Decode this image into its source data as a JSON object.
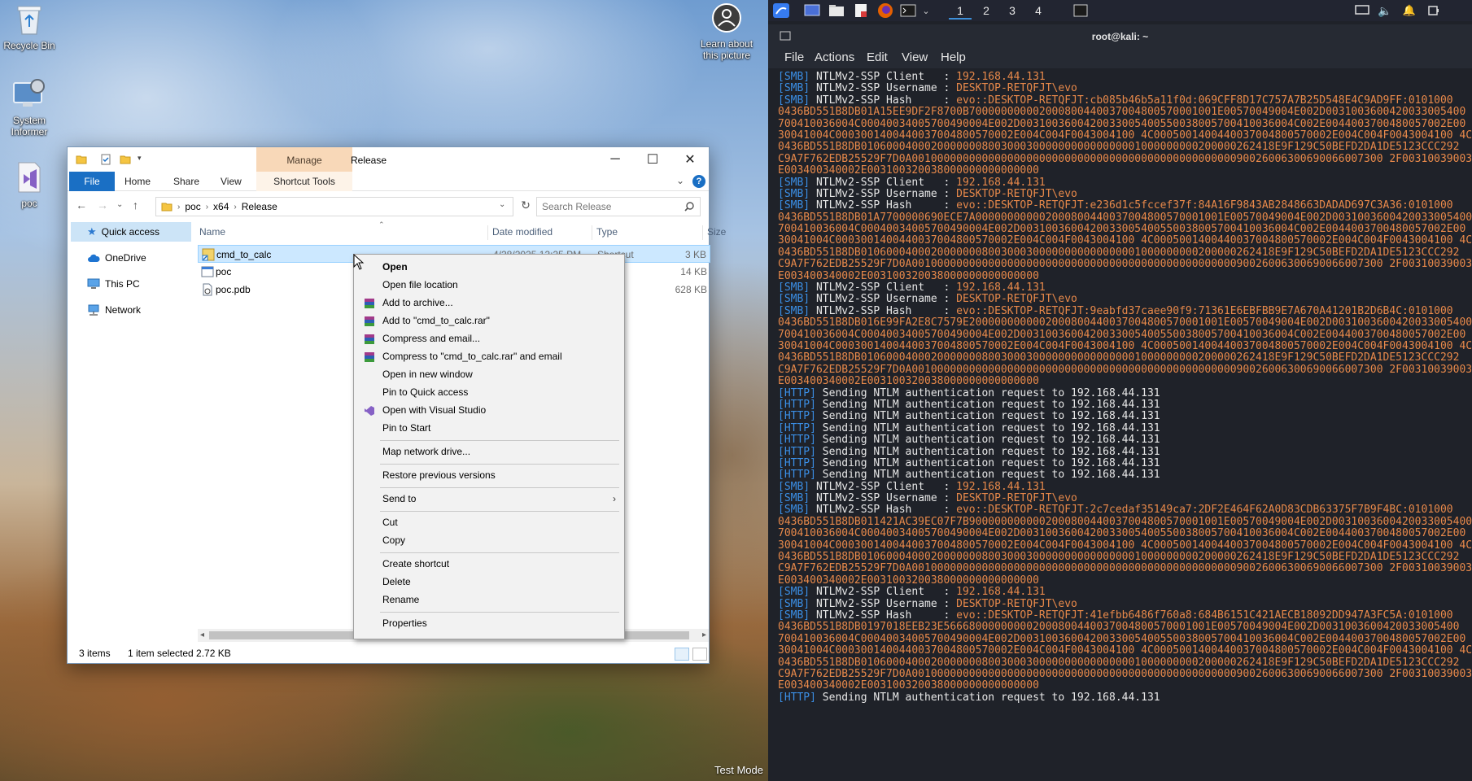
{
  "desktop": {
    "icons": [
      {
        "label": "Recycle Bin",
        "icon": "recycle-bin-icon"
      },
      {
        "label": "System\nInformer",
        "icon": "system-informer-icon"
      },
      {
        "label": "poc",
        "icon": "visual-studio-solution-icon"
      }
    ],
    "learn_label": "Learn about\nthis picture",
    "test_mode": "Test Mode"
  },
  "explorer": {
    "manage_tab": "Manage",
    "title": "Release",
    "ribbon_tabs": {
      "file": "File",
      "home": "Home",
      "share": "Share",
      "view": "View",
      "shortcut_tools": "Shortcut Tools"
    },
    "breadcrumb": [
      "poc",
      "x64",
      "Release"
    ],
    "search_placeholder": "Search Release",
    "nav": {
      "quick_access": "Quick access",
      "onedrive": "OneDrive",
      "this_pc": "This PC",
      "network": "Network"
    },
    "columns": {
      "name": "Name",
      "date": "Date modified",
      "type": "Type",
      "size": "Size"
    },
    "files": [
      {
        "name": "cmd_to_calc",
        "date": "4/28/2025 12:25 PM",
        "type": "Shortcut",
        "size": "3 KB"
      },
      {
        "name": "poc",
        "date": "",
        "type": "",
        "size": "14 KB"
      },
      {
        "name": "poc.pdb",
        "date": "",
        "type": "",
        "size": "628 KB"
      }
    ],
    "status": {
      "items": "3 items",
      "selected": "1 item selected  2.72 KB"
    }
  },
  "context_menu": {
    "open": "Open",
    "open_location": "Open file location",
    "add_archive": "Add to archive...",
    "add_rar": "Add to \"cmd_to_calc.rar\"",
    "compress_email": "Compress and email...",
    "compress_rar_email": "Compress to \"cmd_to_calc.rar\" and email",
    "open_new_window": "Open in new window",
    "pin_quick": "Pin to Quick access",
    "open_vs": "Open with Visual Studio",
    "pin_start": "Pin to Start",
    "map_drive": "Map network drive...",
    "restore": "Restore previous versions",
    "send_to": "Send to",
    "cut": "Cut",
    "copy": "Copy",
    "create_shortcut": "Create shortcut",
    "delete": "Delete",
    "rename": "Rename",
    "properties": "Properties"
  },
  "kali": {
    "workspaces": [
      "1",
      "2",
      "3",
      "4"
    ],
    "window_title": "root@kali: ~",
    "menu": {
      "file": "File",
      "actions": "Actions",
      "edit": "Edit",
      "view": "View",
      "help": "Help"
    },
    "smb_tag": "[SMB]",
    "http_tag": "[HTTP]",
    "label_client": " NTLMv2-SSP Client   : ",
    "label_username": " NTLMv2-SSP Username : ",
    "label_hash": " NTLMv2-SSP Hash     : ",
    "client_ip": "192.168.44.131",
    "username": "DESKTOP-RETQFJT\\evo",
    "http_msg": " Sending NTLM authentication request to 192.168.44.131",
    "blocks": [
      {
        "hash_first": "evo::DESKTOP-RETQFJT:cb085b46b5a11f0d:069CFF8D17C757A7B25D548E4C9AD9FF:0101000",
        "hash_rest": [
          "0436BD551B8DB01A15EE9DF2F8700B700000000002000800440037004800570001001E00570049004E002D0031003600420033005400",
          "700410036004C00040034005700490004E002D0031003600420033005400550038005700410036004C002E0044003700480057002E00",
          "30041004C0003001400440037004800570002E004C004F0043004100 4C0005001400440037004800570002E004C004F0043004100 4C00",
          "0436BD551B8DB01060004000200000008003000300000000000000001000000000200000262418E9F129C50BEFD2DA1DE5123CCC292",
          "C9A7F762EDB25529F7D0A00100000000000000000000000000000000000000000000000090026006300690066007300 2F003100390032002E00310",
          "E003400340002E003100320038000000000000000"
        ]
      },
      {
        "hash_first": "evo::DESKTOP-RETQFJT:e236d1c5fccef37f:84A16F9843AB2848663DADAD697C3A36:0101000",
        "hash_rest": [
          "0436BD551B8DB01A7700000690ECE7A000000000002000800440037004800570001001E00570049004E002D0031003600420033005400",
          "700410036004C00040034005700490004E002D0031003600420033005400550038005700410036004C002E0044003700480057002E00",
          "30041004C0003001400440037004800570002E004C004F0043004100 4C0005001400440037004800570002E004C004F0043004100 4C00",
          "0436BD551B8DB01060004000200000008003000300000000000000001000000000200000262418E9F129C50BEFD2DA1DE5123CCC292",
          "C9A7F762EDB25529F7D0A00100000000000000000000000000000000000000000000000090026006300690066007300 2F003100390032002E00310",
          "E003400340002E003100320038000000000000000"
        ]
      },
      {
        "hash_first": "evo::DESKTOP-RETQFJT:9eabfd37caee90f9:71361E6EBFBB9E7A670A41201B2D6B4C:0101000",
        "hash_rest": [
          "0436BD551B8DB016E99FA2E8C7579E2000000000002000800440037004800570001001E00570049004E002D0031003600420033005400",
          "700410036004C00040034005700490004E002D0031003600420033005400550038005700410036004C002E0044003700480057002E00",
          "30041004C0003001400440037004800570002E004C004F0043004100 4C0005001400440037004800570002E004C004F0043004100 4C00",
          "0436BD551B8DB01060004000200000008003000300000000000000001000000000200000262418E9F129C50BEFD2DA1DE5123CCC292",
          "C9A7F762EDB25529F7D0A00100000000000000000000000000000000000000000000000090026006300690066007300 2F003100390032002E00310",
          "E003400340002E003100320038000000000000000"
        ]
      },
      {
        "hash_first": "evo::DESKTOP-RETQFJT:2c7cedaf35149ca7:2DF2E464F62A0D83CDB63375F7B9F4BC:0101000",
        "hash_rest": [
          "0436BD551B8DB011421AC39EC07F7B9000000000002000800440037004800570001001E00570049004E002D0031003600420033005400",
          "700410036004C00040034005700490004E002D0031003600420033005400550038005700410036004C002E0044003700480057002E00",
          "30041004C0003001400440037004800570002E004C004F0043004100 4C0005001400440037004800570002E004C004F0043004100 4C00",
          "0436BD551B8DB01060004000200000008003000300000000000000001000000000200000262418E9F129C50BEFD2DA1DE5123CCC292",
          "C9A7F762EDB25529F7D0A00100000000000000000000000000000000000000000000000090026006300690066007300 2F003100390032002E00310",
          "E003400340002E003100320038000000000000000"
        ]
      },
      {
        "hash_first": "evo::DESKTOP-RETQFJT:41efbb6486f760a8:684B6151C421AECB18092DD947A3FC5A:0101000",
        "hash_rest": [
          "0436BD551B8DB0197018EEB23E566680000000002000800440037004800570001001E00570049004E002D0031003600420033005400",
          "700410036004C00040034005700490004E002D0031003600420033005400550038005700410036004C002E0044003700480057002E00",
          "30041004C0003001400440037004800570002E004C004F0043004100 4C0005001400440037004800570002E004C004F0043004100 4C00",
          "0436BD551B8DB01060004000200000008003000300000000000000001000000000200000262418E9F129C50BEFD2DA1DE5123CCC292",
          "C9A7F762EDB25529F7D0A00100000000000000000000000000000000000000000000000090026006300690066007300 2F003100390032002E00310",
          "E003400340002E003100320038000000000000000"
        ]
      }
    ],
    "http_count_after_block3": 8,
    "http_count_end": 1
  }
}
